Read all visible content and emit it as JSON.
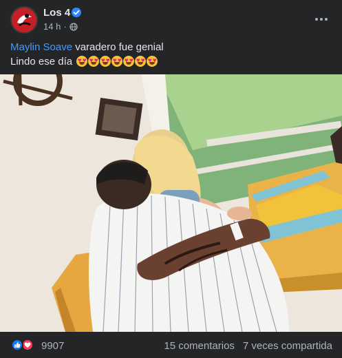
{
  "post": {
    "page_name": "Los 4",
    "timestamp": "14 h",
    "separator": "·",
    "text_mention": "Maylin Soave",
    "text_line1_rest": " varadero fue genial",
    "text_line2": "Lindo ese día",
    "emoji_count": 7,
    "photo_alt": "Foto de la publicación"
  },
  "footer": {
    "reaction_count": "9907",
    "comments": "15 comentarios",
    "shares": "7 veces compartida"
  },
  "colors": {
    "background": "#242526",
    "text": "#e4e6eb",
    "secondary_text": "#b0b3b8",
    "link": "#4599ff",
    "verified": "#2d88ff",
    "like": "#1877f2",
    "love": "#f33e58"
  },
  "icons": [
    "avatar",
    "verified-badge-icon",
    "globe-icon",
    "more-options-icon",
    "like-reaction-icon",
    "love-reaction-icon",
    "heart-eyes-emoji"
  ]
}
